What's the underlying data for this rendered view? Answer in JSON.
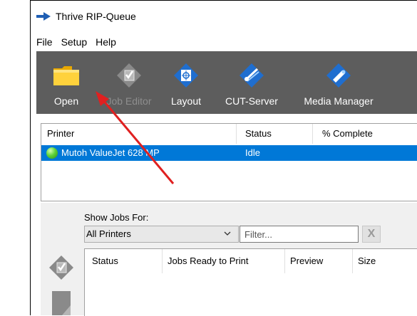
{
  "window": {
    "title": "Thrive RIP-Queue",
    "icon": "thrive-arrow-icon"
  },
  "menu": {
    "items": [
      "File",
      "Setup",
      "Help"
    ]
  },
  "toolbar": {
    "background": "#5d5d5d",
    "buttons": [
      {
        "label": "Open",
        "icon": "folder-icon",
        "enabled": true
      },
      {
        "label": "Job Editor",
        "icon": "job-editor-icon",
        "enabled": false
      },
      {
        "label": "Layout",
        "icon": "layout-icon",
        "enabled": true
      },
      {
        "label": "CUT-Server",
        "icon": "cut-server-icon",
        "enabled": true
      },
      {
        "label": "Media Manager",
        "icon": "media-manager-icon",
        "enabled": true
      }
    ]
  },
  "printers": {
    "columns": [
      "Printer",
      "Status",
      "% Complete"
    ],
    "rows": [
      {
        "printer": "Mutoh ValueJet 628 MP",
        "status": "Idle",
        "complete": "",
        "selected": true,
        "status_color": "#4cc52c"
      }
    ],
    "selection_color": "#0078d7"
  },
  "jobs": {
    "show_jobs_label": "Show Jobs For:",
    "selected_printer": "All Printers",
    "filter_placeholder": "Filter...",
    "clear_label": "X",
    "columns": [
      "Status",
      "Jobs Ready to Print",
      "Preview",
      "Size"
    ]
  },
  "annotation": {
    "color": "#e02020",
    "points_to": "Open"
  }
}
